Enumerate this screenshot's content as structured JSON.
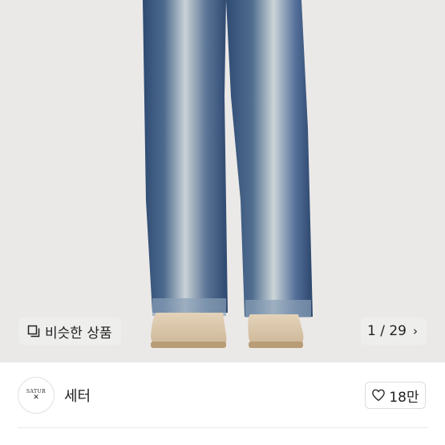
{
  "product": {
    "similar_label": "비슷한 상품",
    "image_counter": "1 / 29",
    "icons": {
      "similar": "similar-items-icon",
      "next": "chevron-right-icon"
    }
  },
  "shop": {
    "name": "세터",
    "logo_text": "SATUR",
    "like_count": "18만",
    "icons": {
      "like": "heart-icon"
    }
  }
}
